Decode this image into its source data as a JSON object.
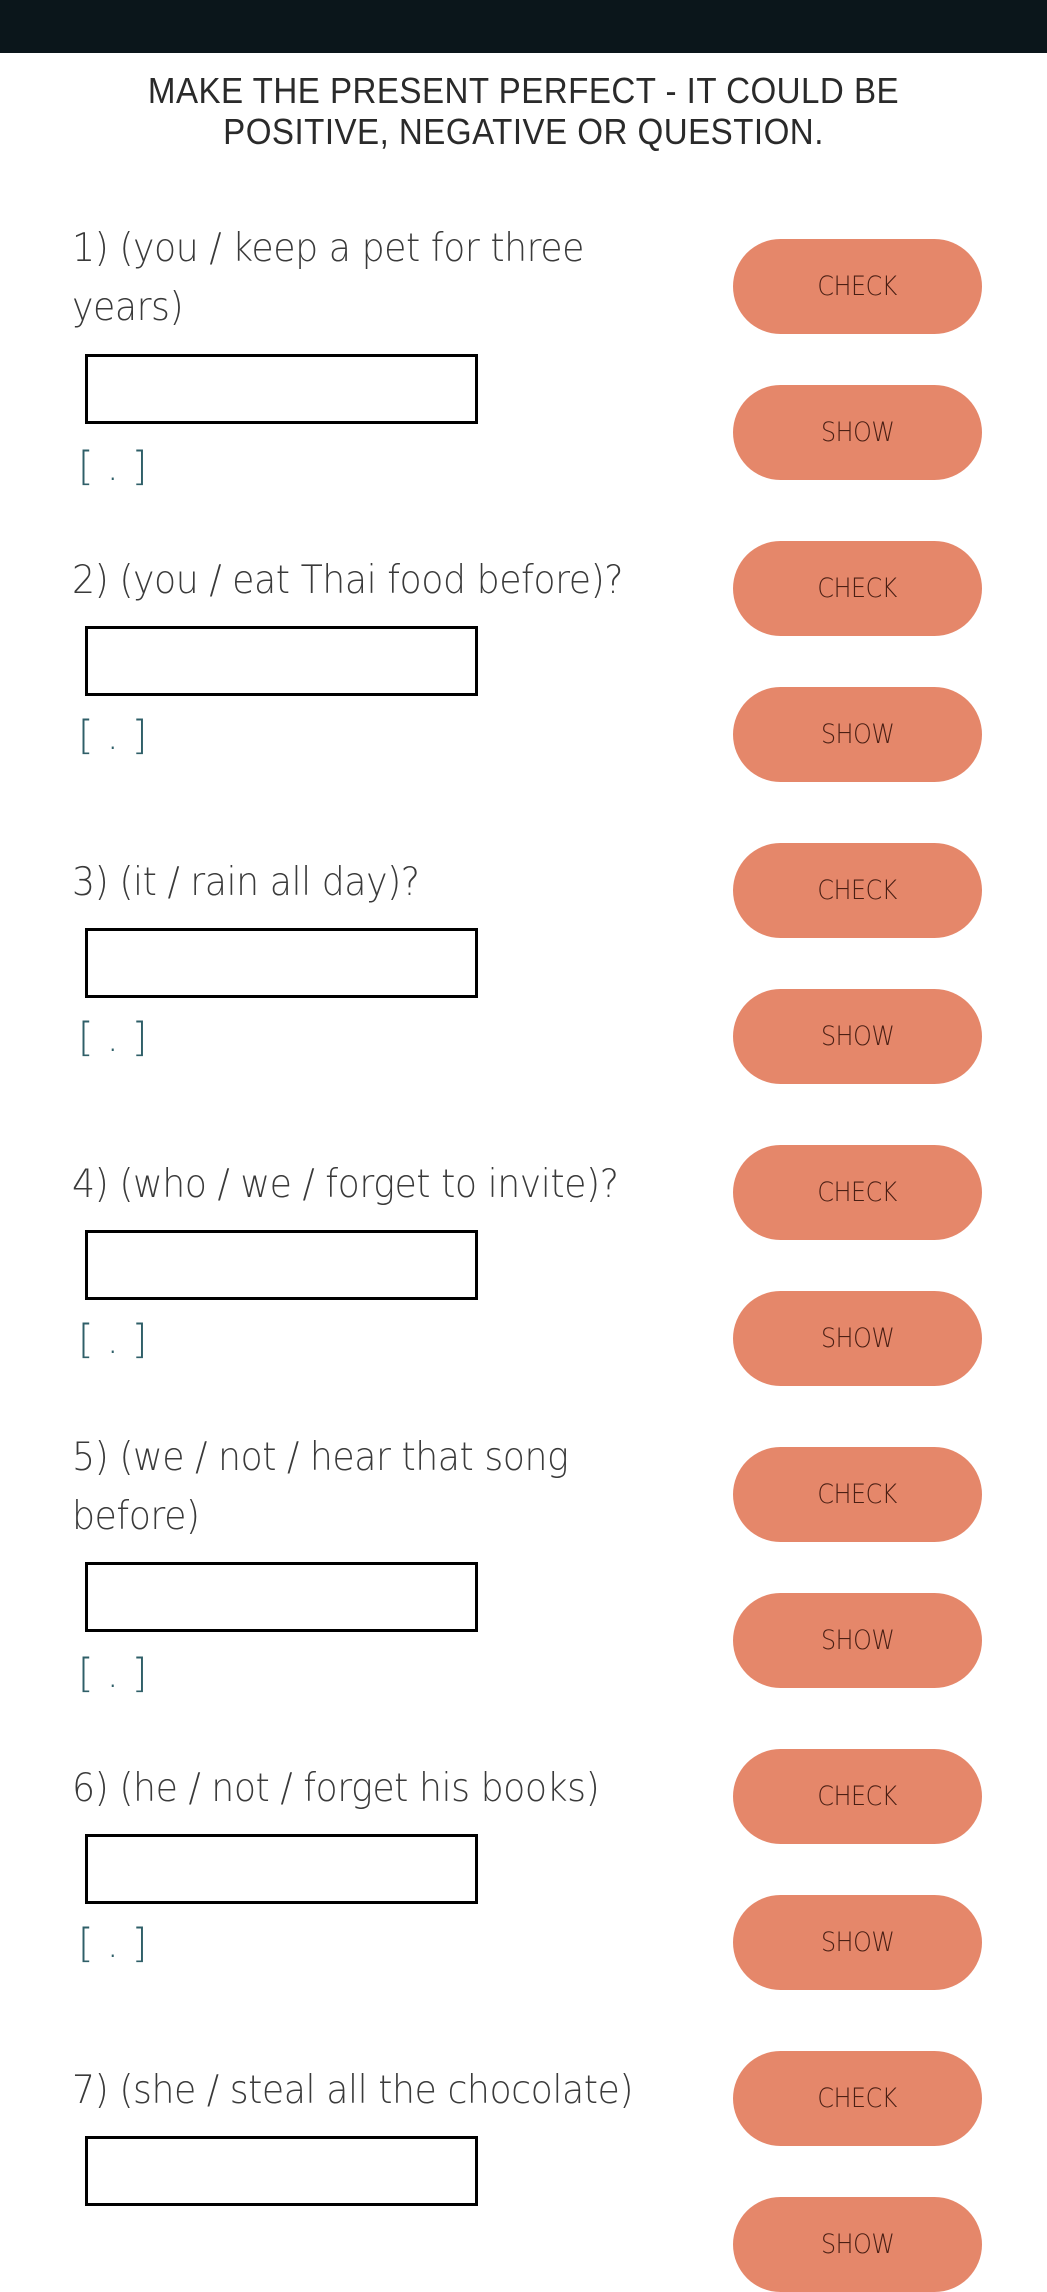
{
  "header": {
    "title_line1": "MAKE THE PRESENT PERFECT - IT COULD BE",
    "title_line2": "POSITIVE, NEGATIVE OR QUESTION."
  },
  "colors": {
    "topbar": "#0b161b",
    "button_bg": "#e5876a",
    "button_text": "#4a1f14",
    "feedback_text": "#2f5f68"
  },
  "buttons": {
    "check_label": "CHECK",
    "show_label": "SHOW"
  },
  "questions": [
    {
      "number": 1,
      "prompt": "1) (you / keep a pet for three years)",
      "answer_value": "",
      "feedback": "[ . ]"
    },
    {
      "number": 2,
      "prompt": "2) (you / eat Thai food before)?",
      "answer_value": "",
      "feedback": "[ . ]"
    },
    {
      "number": 3,
      "prompt": "3) (it / rain all day)?",
      "answer_value": "",
      "feedback": "[ . ]"
    },
    {
      "number": 4,
      "prompt": "4) (who / we / forget to invite)?",
      "answer_value": "",
      "feedback": "[ . ]"
    },
    {
      "number": 5,
      "prompt": "5) (we / not / hear that song before)",
      "answer_value": "",
      "feedback": "[ . ]"
    },
    {
      "number": 6,
      "prompt": "6) (he / not / forget his books)",
      "answer_value": "",
      "feedback": "[ . ]"
    },
    {
      "number": 7,
      "prompt": "7) (she / steal all the chocolate)",
      "answer_value": "",
      "feedback": ""
    }
  ]
}
